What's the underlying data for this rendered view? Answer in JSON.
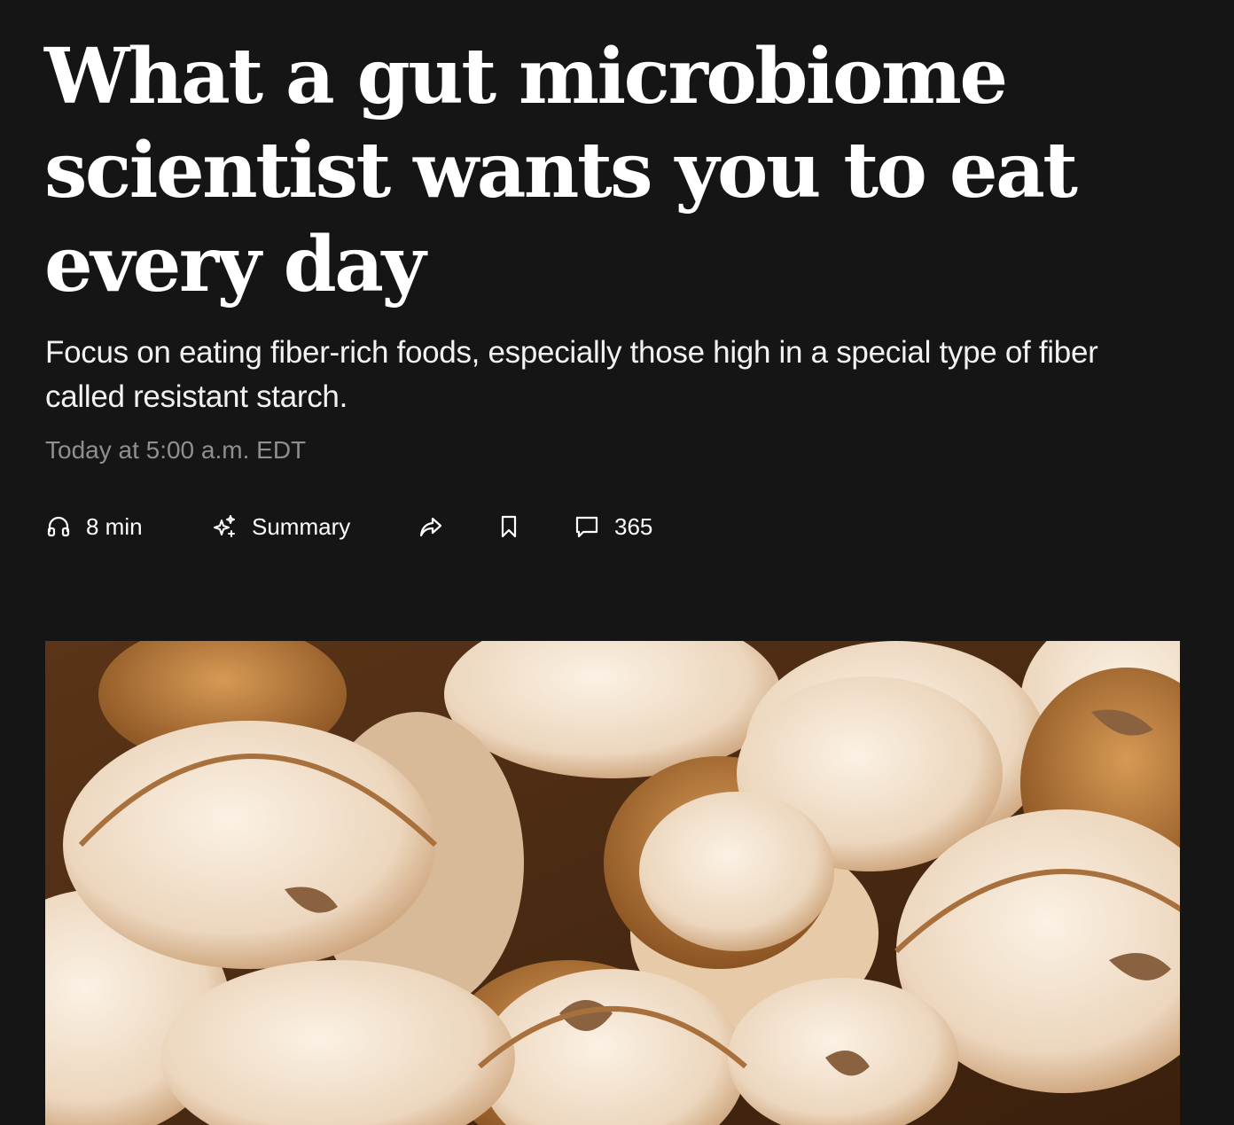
{
  "article": {
    "headline": "What a gut microbiome scientist wants you to eat every day",
    "subheadline": "Focus on eating fiber-rich foods, especially those high in a special type of fiber called resistant starch.",
    "timestamp": "Today at 5:00 a.m. EDT"
  },
  "toolbar": {
    "listen": {
      "icon": "headphones-icon",
      "label": "8 min"
    },
    "summary": {
      "icon": "sparkle-icon",
      "label": "Summary"
    },
    "share": {
      "icon": "share-arrow-icon"
    },
    "save": {
      "icon": "bookmark-icon"
    },
    "comments": {
      "icon": "comment-icon",
      "count": "365"
    }
  },
  "hero_image": {
    "subject": "sliced mushrooms"
  },
  "colors": {
    "background": "#151515",
    "text": "#ffffff",
    "muted_text": "#8f8f8f"
  }
}
